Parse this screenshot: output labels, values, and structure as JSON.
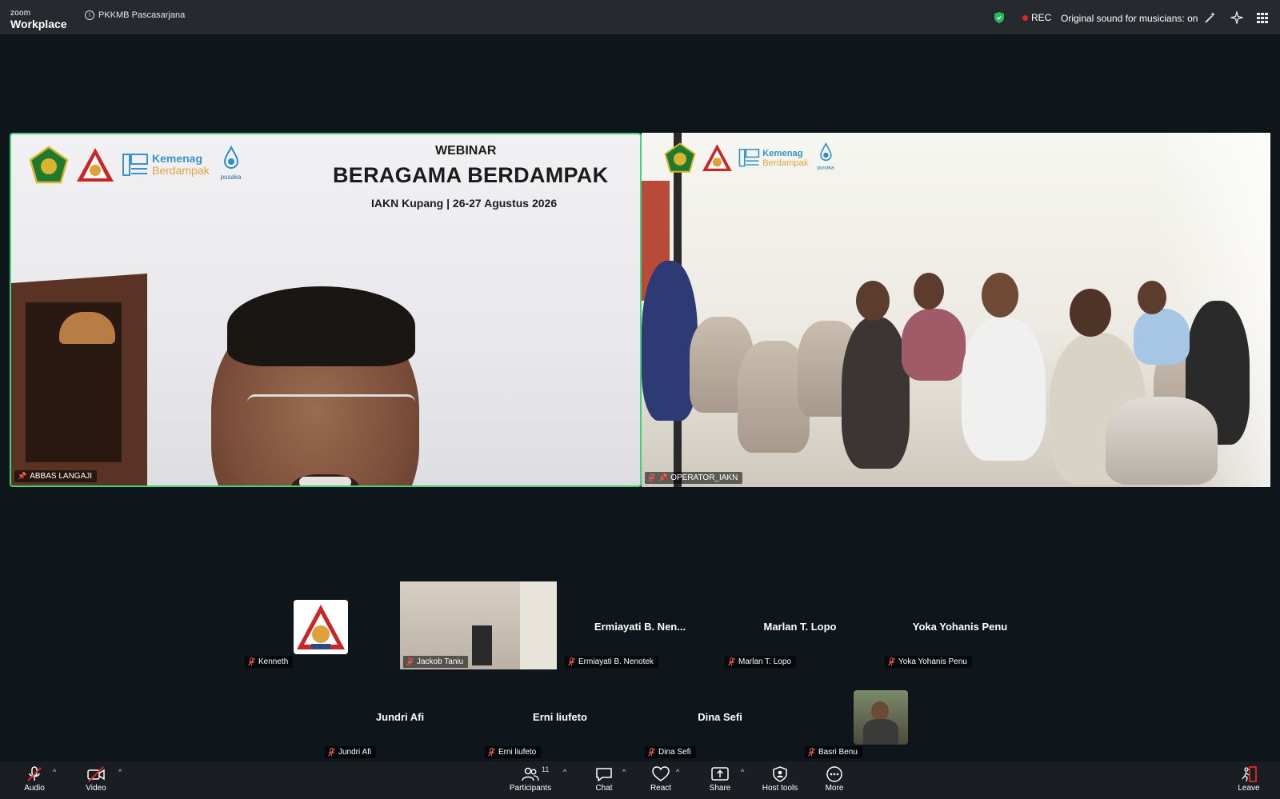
{
  "app": {
    "brand_small": "zoom",
    "brand_large": "Workplace",
    "meeting_title": "PKKMB Pascasarjana"
  },
  "topbar": {
    "rec_label": "REC",
    "sound_status": "Original sound for musicians: on"
  },
  "main_tiles": {
    "speaker": {
      "name": "ABBAS LANGAJI",
      "banner_webinar": "WEBINAR",
      "banner_title": "BERAGAMA BERDAMPAK",
      "banner_sub": "IAKN Kupang | 26-27 Agustus 2026",
      "logo_text_1": "Kemenag",
      "logo_text_2": "Berdampak",
      "logo_text_3": "pusaka"
    },
    "room": {
      "name": "OPERATOR_IAKN",
      "logo_text_1": "Kemenag",
      "logo_text_2": "Berdampak",
      "logo_text_3": "pusaka"
    }
  },
  "gallery": {
    "row1": [
      {
        "name": "Kenneth",
        "display": ""
      },
      {
        "name": "Jackob Taniu",
        "display": ""
      },
      {
        "name": "Ermiayati B. Nenotek",
        "display": "Ermiayati B. Nen..."
      },
      {
        "name": "Marlan T. Lopo",
        "display": "Marlan T. Lopo"
      },
      {
        "name": "Yoka Yohanis Penu",
        "display": "Yoka Yohanis Penu"
      }
    ],
    "row2": [
      {
        "name": "Jundri Afi",
        "display": "Jundri Afi"
      },
      {
        "name": "Erni liufeto",
        "display": "Erni liufeto"
      },
      {
        "name": "Dina Sefi",
        "display": "Dina Sefi"
      },
      {
        "name": "Basri Benu",
        "display": ""
      }
    ]
  },
  "bottombar": {
    "audio": "Audio",
    "video": "Video",
    "participants": "Participants",
    "participants_count": "11",
    "chat": "Chat",
    "react": "React",
    "share": "Share",
    "host_tools": "Host tools",
    "more": "More",
    "leave": "Leave"
  },
  "colors": {
    "active_speaker_border": "#3fd27b",
    "rec_dot": "#e02828",
    "leave_red": "#e02828",
    "background": "#0f161b"
  }
}
